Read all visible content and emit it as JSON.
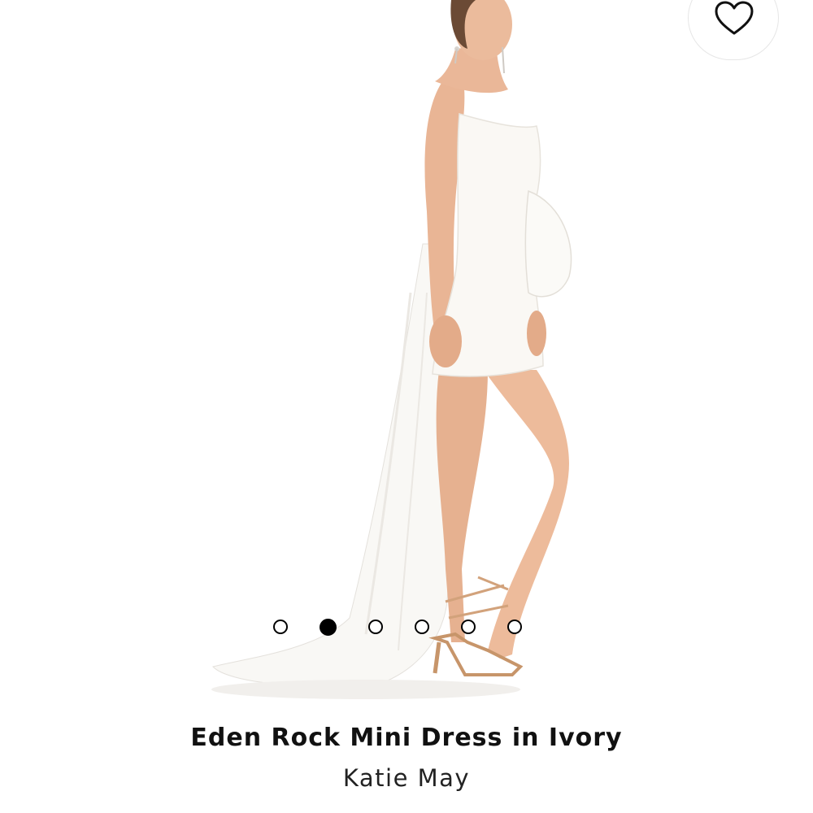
{
  "product": {
    "title": "Eden Rock Mini Dress in Ivory",
    "brand": "Katie May"
  },
  "gallery": {
    "dot_count": 6,
    "active_index": 1
  },
  "wishlist": {
    "icon": "heart-outline-icon"
  },
  "colors": {
    "background": "#ffffff",
    "text": "#111111",
    "dress": "#f7f4ef",
    "skin": "#e8b493"
  }
}
